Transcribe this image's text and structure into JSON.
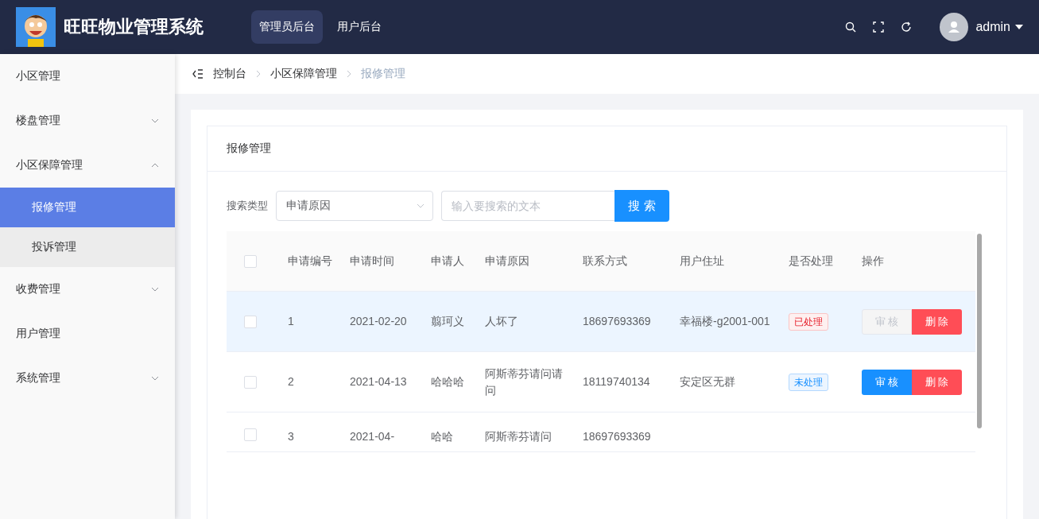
{
  "header": {
    "title": "旺旺物业管理系统",
    "nav": [
      {
        "label": "管理员后台",
        "selected": true
      },
      {
        "label": "用户后台",
        "selected": false
      }
    ],
    "user": "admin"
  },
  "sidebar": {
    "items": [
      {
        "label": "小区管理"
      },
      {
        "label": "楼盘管理",
        "expanded": false
      },
      {
        "label": "小区保障管理",
        "expanded": true,
        "children": [
          {
            "label": "报修管理",
            "selected": true
          },
          {
            "label": "投诉管理",
            "selected": false
          }
        ]
      },
      {
        "label": "收费管理",
        "expanded": false
      },
      {
        "label": "用户管理"
      },
      {
        "label": "系统管理",
        "expanded": false
      }
    ]
  },
  "breadcrumb": [
    {
      "label": "控制台",
      "current": false
    },
    {
      "label": "小区保障管理",
      "current": false
    },
    {
      "label": "报修管理",
      "current": true
    }
  ],
  "panel_title": "报修管理",
  "search": {
    "label": "搜索类型",
    "type_value": "申请原因",
    "placeholder": "输入要搜索的文本",
    "button": "搜 索"
  },
  "table": {
    "all_selected": false,
    "columns": [
      "申请编号",
      "申请时间",
      "申请人",
      "申请原因",
      "联系方式",
      "用户住址",
      "是否处理",
      "操作"
    ],
    "rows": [
      {
        "selected": false,
        "highlighted": true,
        "cells": [
          "1",
          "2021-02-20",
          "翦珂义",
          "人坏了",
          "18697693369",
          "幸福楼-g2001-001"
        ],
        "status": {
          "text": "已处理",
          "processed": true
        },
        "actions": [
          {
            "label": "审 核",
            "kind": "audit",
            "disabled": true
          },
          {
            "label": "删 除",
            "kind": "delete",
            "disabled": false
          }
        ]
      },
      {
        "selected": false,
        "highlighted": false,
        "cells": [
          "2",
          "2021-04-13",
          "哈哈哈",
          "阿斯蒂芬请问请问",
          "18119740134",
          "安定区无群"
        ],
        "status": {
          "text": "未处理",
          "processed": false
        },
        "actions": [
          {
            "label": "审 核",
            "kind": "audit",
            "disabled": false
          },
          {
            "label": "删 除",
            "kind": "delete",
            "disabled": false
          }
        ]
      },
      {
        "selected": false,
        "highlighted": false,
        "cells": [
          "3",
          "2021-04-",
          "哈哈",
          "阿斯蒂芬请问",
          "18697693369"
        ]
      }
    ]
  }
}
